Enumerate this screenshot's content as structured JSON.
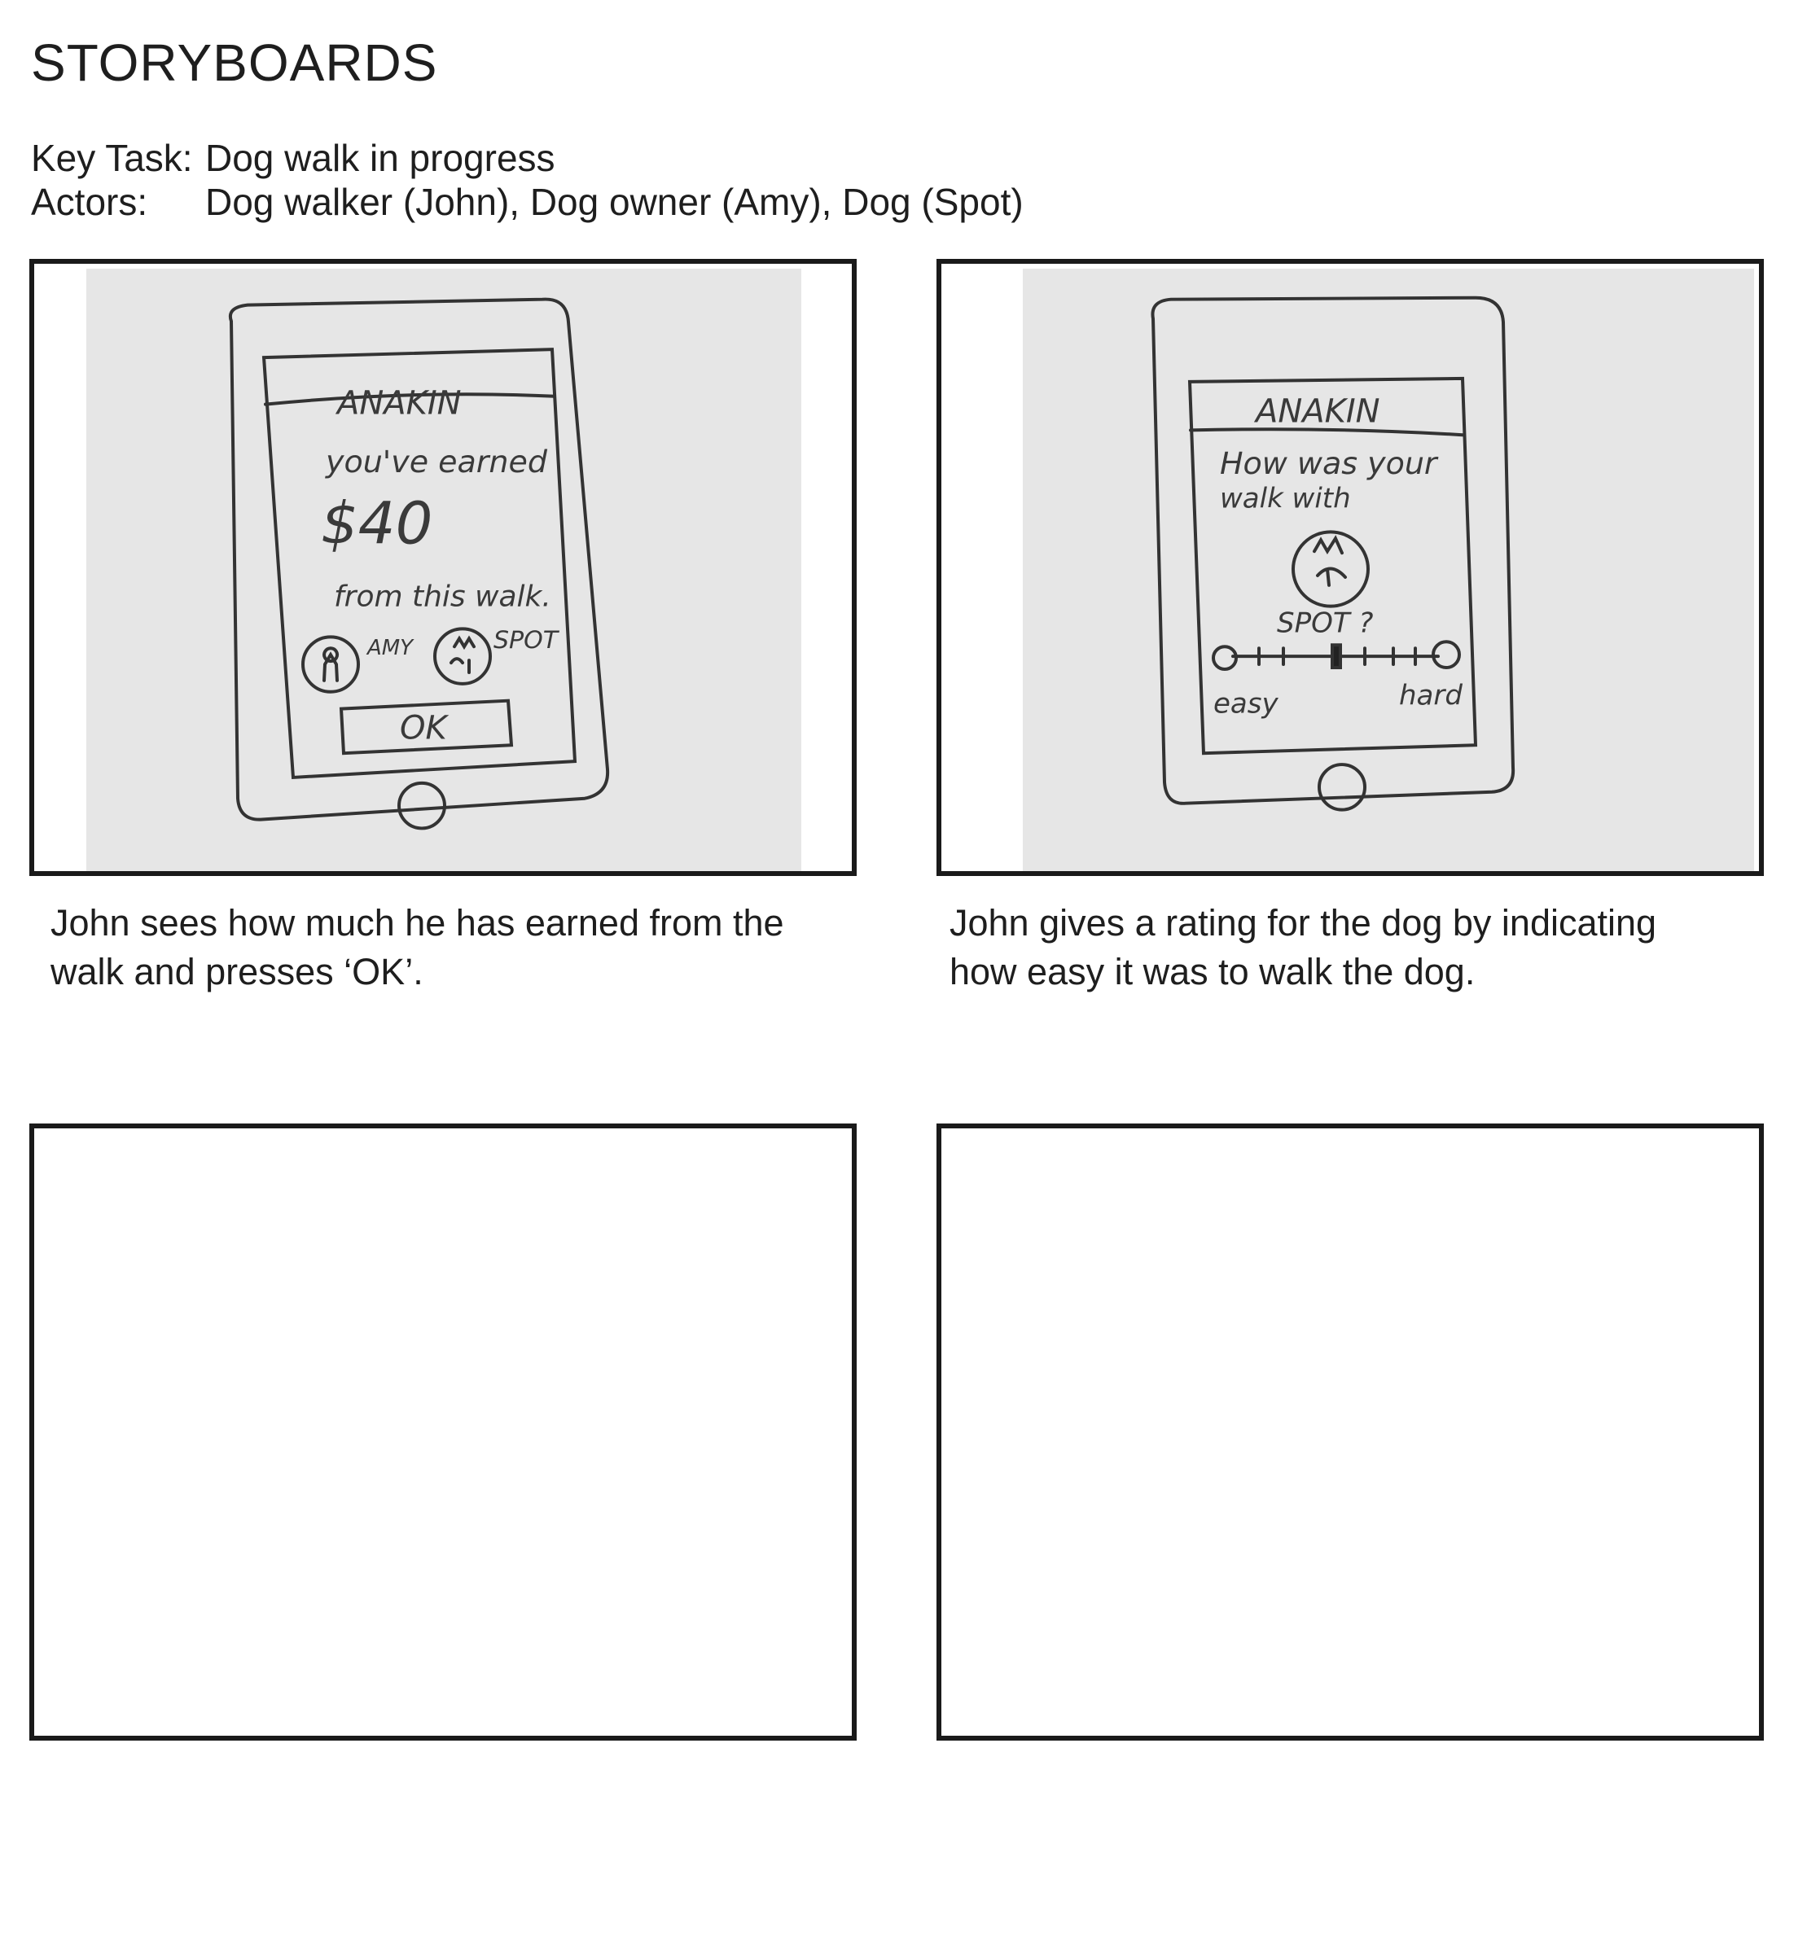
{
  "page": {
    "title": "STORYBOARDS",
    "key_task_label": "Key Task:",
    "key_task_value": "Dog walk in progress",
    "actors_label": "Actors:",
    "actors_value": "Dog walker (John), Dog owner (Amy), Dog (Spot)"
  },
  "panels": [
    {
      "sketch": {
        "app_name": "ANAKIN",
        "earned_line": "you've earned",
        "amount": "$40",
        "from_line": "from this walk.",
        "owner_label": "AMY",
        "dog_label": "SPOT",
        "button_label": "OK"
      },
      "caption_line1": "John sees how much he has earned from the",
      "caption_line2": "walk and presses ‘OK’."
    },
    {
      "sketch": {
        "app_name": "ANAKIN",
        "question_line1": "How was your",
        "question_line2": "walk with",
        "dog_name": "SPOT ?",
        "scale_low": "easy",
        "scale_high": "hard"
      },
      "caption_line1": "John gives a rating for the dog by indicating",
      "caption_line2": "how easy it was to walk the dog."
    },
    {
      "caption_line1": "",
      "caption_line2": ""
    },
    {
      "caption_line1": "",
      "caption_line2": ""
    }
  ]
}
